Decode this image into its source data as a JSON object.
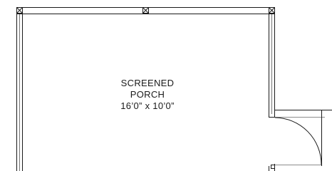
{
  "floor_plan": {
    "room": {
      "name_line1": "SCREENED",
      "name_line2": "PORCH",
      "dimensions": "16’0” x 10’0”"
    },
    "colors": {
      "wall": "#1a1a1a",
      "background": "#ffffff"
    }
  }
}
